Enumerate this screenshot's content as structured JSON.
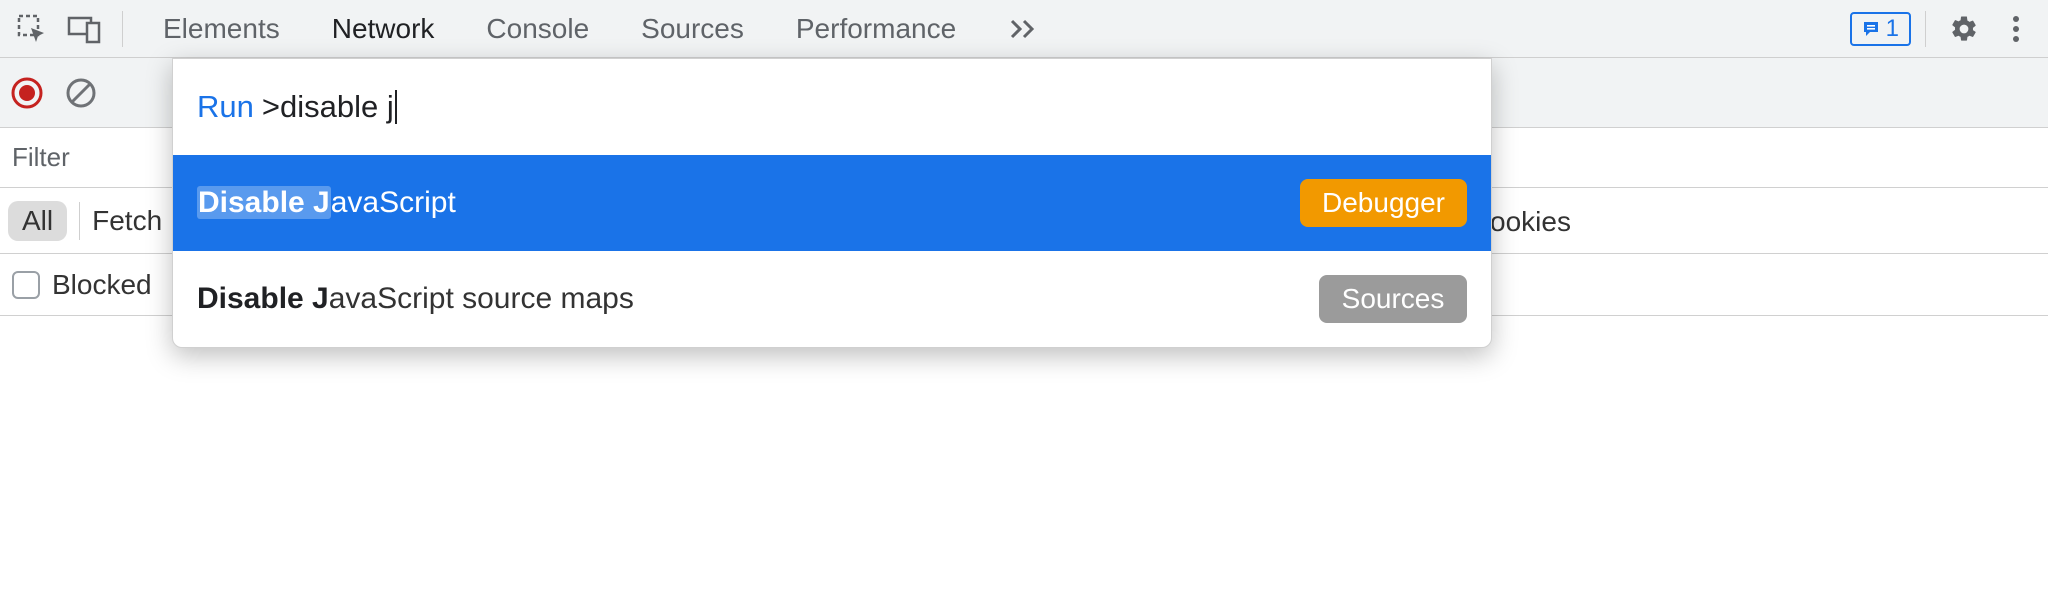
{
  "tabs": {
    "elements": "Elements",
    "network": "Network",
    "console": "Console",
    "sources": "Sources",
    "performance": "Performance"
  },
  "issues_count": "1",
  "filterbar_label": "Filter",
  "type_filter_all": "All",
  "type_filter_fetch_truncated": "Fetch",
  "blocked_label_truncated": "Blocked",
  "trailing_text": "ookies",
  "command_palette": {
    "run_label": "Run",
    "prefix": ">",
    "query": "disable j",
    "results": [
      {
        "matched": "Disable J",
        "rest": "avaScript",
        "panel": "Debugger",
        "selected": true
      },
      {
        "matched": "Disable J",
        "rest": "avaScript source maps",
        "panel": "Sources",
        "selected": false
      }
    ]
  }
}
